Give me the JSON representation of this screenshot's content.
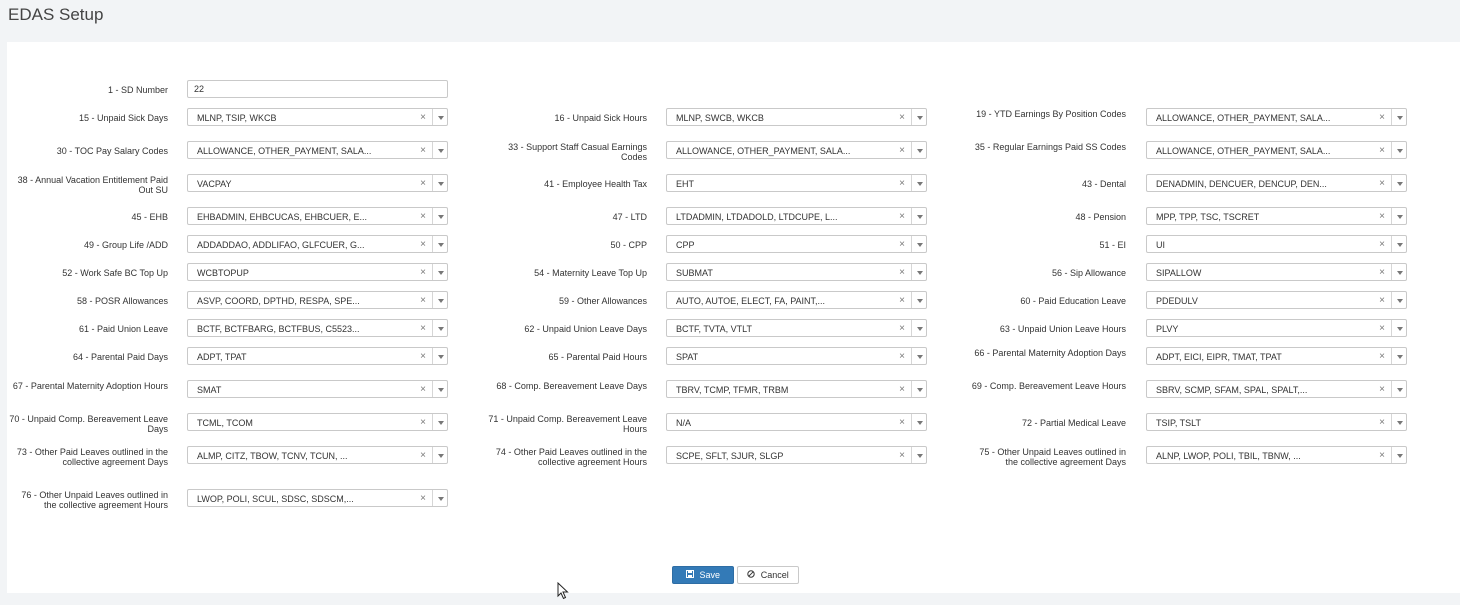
{
  "page": {
    "title": "EDAS Setup"
  },
  "fields": {
    "sd_number": {
      "label": "1 - SD Number",
      "value": "22"
    },
    "f15": {
      "label": "15 - Unpaid Sick Days",
      "value": "MLNP, TSIP, WKCB"
    },
    "f16": {
      "label": "16 - Unpaid Sick Hours",
      "value": "MLNP, SWCB, WKCB"
    },
    "f19": {
      "label": "19 - YTD Earnings By Position Codes",
      "value": "ALLOWANCE, OTHER_PAYMENT, SALA..."
    },
    "f30": {
      "label": "30 - TOC Pay Salary Codes",
      "value": "ALLOWANCE, OTHER_PAYMENT, SALA..."
    },
    "f33": {
      "label": "33 - Support Staff Casual Earnings Codes",
      "value": "ALLOWANCE, OTHER_PAYMENT, SALA..."
    },
    "f35": {
      "label": "35 - Regular Earnings Paid SS Codes",
      "value": "ALLOWANCE, OTHER_PAYMENT, SALA..."
    },
    "f38": {
      "label": "38 - Annual Vacation Entitlement Paid Out SU",
      "value": "VACPAY"
    },
    "f41": {
      "label": "41 - Employee Health Tax",
      "value": "EHT"
    },
    "f43": {
      "label": "43 - Dental",
      "value": "DENADMIN, DENCUER, DENCUP, DEN..."
    },
    "f45": {
      "label": "45 - EHB",
      "value": "EHBADMIN, EHBCUCAS, EHBCUER, E..."
    },
    "f47": {
      "label": "47 - LTD",
      "value": "LTDADMIN, LTDADOLD, LTDCUPE, L..."
    },
    "f48": {
      "label": "48 - Pension",
      "value": "MPP, TPP, TSC, TSCRET"
    },
    "f49": {
      "label": "49 - Group Life /ADD",
      "value": "ADDADDAO, ADDLIFAO, GLFCUER, G..."
    },
    "f50": {
      "label": "50 - CPP",
      "value": "CPP"
    },
    "f51": {
      "label": "51 - EI",
      "value": "UI"
    },
    "f52": {
      "label": "52 - Work Safe BC Top Up",
      "value": "WCBTOPUP"
    },
    "f54": {
      "label": "54 - Maternity Leave Top Up",
      "value": "SUBMAT"
    },
    "f56": {
      "label": "56 - Sip Allowance",
      "value": "SIPALLOW"
    },
    "f58": {
      "label": "58 - POSR Allowances",
      "value": "ASVP, COORD, DPTHD, RESPA, SPE..."
    },
    "f59": {
      "label": "59 - Other Allowances",
      "value": "AUTO, AUTOE, ELECT, FA, PAINT,..."
    },
    "f60": {
      "label": "60 - Paid Education Leave",
      "value": "PDEDULV"
    },
    "f61": {
      "label": "61 - Paid Union Leave",
      "value": "BCTF, BCTFBARG, BCTFBUS, C5523..."
    },
    "f62": {
      "label": "62 - Unpaid Union Leave Days",
      "value": "BCTF, TVTA, VTLT"
    },
    "f63": {
      "label": "63 - Unpaid Union Leave Hours",
      "value": "PLVY"
    },
    "f64": {
      "label": "64 - Parental Paid Days",
      "value": "ADPT, TPAT"
    },
    "f65": {
      "label": "65 - Parental Paid Hours",
      "value": "SPAT"
    },
    "f66": {
      "label": "66 - Parental Maternity Adoption Days",
      "value": "ADPT, EICI, EIPR, TMAT, TPAT"
    },
    "f67": {
      "label": "67 - Parental Maternity Adoption Hours",
      "value": "SMAT"
    },
    "f68": {
      "label": "68 - Comp. Bereavement Leave Days",
      "value": "TBRV, TCMP, TFMR, TRBM"
    },
    "f69": {
      "label": "69 - Comp. Bereavement Leave Hours",
      "value": "SBRV, SCMP, SFAM, SPAL, SPALT,..."
    },
    "f70": {
      "label": "70 - Unpaid Comp. Bereavement Leave Days",
      "value": "TCML, TCOM"
    },
    "f71": {
      "label": "71 - Unpaid Comp. Bereavement Leave Hours",
      "value": "N/A"
    },
    "f72": {
      "label": "72 - Partial Medical Leave",
      "value": "TSIP, TSLT"
    },
    "f73": {
      "label": "73 - Other Paid Leaves outlined in the collective agreement Days",
      "value": "ALMP, CITZ, TBOW, TCNV, TCUN, ..."
    },
    "f74": {
      "label": "74 - Other Paid Leaves outlined in the collective agreement Hours",
      "value": "SCPE, SFLT, SJUR, SLGP"
    },
    "f75": {
      "label": "75 - Other Unpaid Leaves outlined in the collective agreement Days",
      "value": "ALNP, LWOP, POLI, TBIL, TBNW, ..."
    },
    "f76": {
      "label": "76 - Other Unpaid Leaves outlined in the collective agreement Hours",
      "value": "LWOP, POLI, SCUL, SDSC, SDSCM,..."
    }
  },
  "actions": {
    "save_label": "Save",
    "cancel_label": "Cancel"
  },
  "icons": {
    "clear": "×",
    "save": "floppy-disk-icon",
    "cancel": "ban-icon"
  },
  "colors": {
    "primary": "#337ab7",
    "background": "#f2f4f6"
  }
}
